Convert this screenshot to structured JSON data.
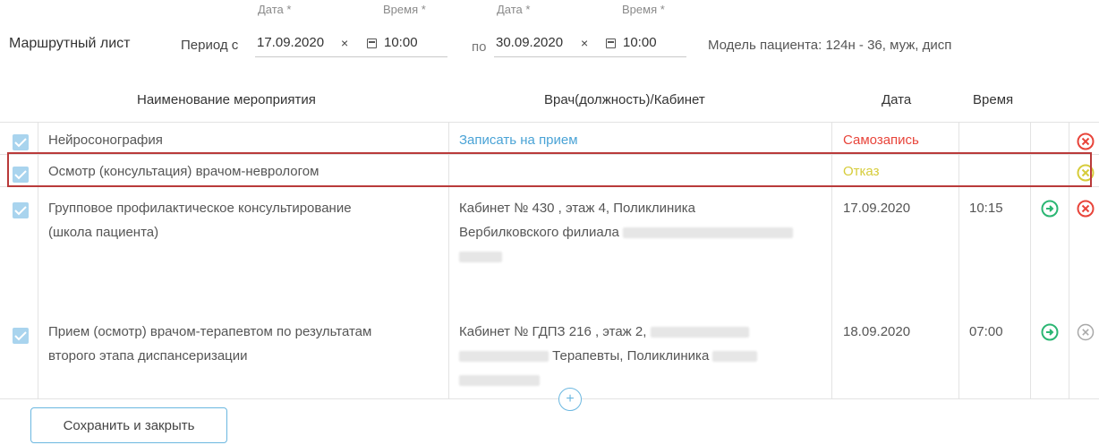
{
  "header": {
    "title": "Маршрутный лист",
    "period_from_label": "Период с",
    "date_from_label": "Дата *",
    "time_from_label": "Время *",
    "date_from": "17.09.2020",
    "time_from": "10:00",
    "to_label": "по",
    "date_to_label": "Дата *",
    "time_to_label": "Время *",
    "date_to": "30.09.2020",
    "time_to": "10:00",
    "clear_symbol": "×",
    "patient_model": "Модель пациента: 124н - 36, муж, дисп"
  },
  "table": {
    "columns": [
      "Наименование мероприятия",
      "Врач(должность)/Кабинет",
      "Дата",
      "Время"
    ],
    "rows": [
      {
        "name": "Нейросонография",
        "doctor": "Записать на прием",
        "date": "Самозапись",
        "time": "",
        "status_icon": "cancel-circle-red-icon"
      },
      {
        "name": "Осмотр (консультация) врачом-неврологом",
        "doctor": "",
        "date": "Отказ",
        "time": "",
        "status_icon": "cancel-circle-yellow-icon"
      },
      {
        "name_line1": "Групповое профилактическое консультирование",
        "name_line2": "(школа пациента)",
        "doctor_line1": "Кабинет № 430 , этаж 4, Поликлиника",
        "doctor_line2": "Вербилковского филиала",
        "date": "17.09.2020",
        "time": "10:15",
        "status_icon": "cancel-circle-red-icon"
      },
      {
        "name_line1": "Прием (осмотр) врачом-терапевтом по результатам",
        "name_line2": "второго этапа диспансеризации",
        "doctor_line1": "Кабинет № ГДПЗ 216 , этаж 2,",
        "doctor_line2": "Терапевты, Поликлиника",
        "date": "18.09.2020",
        "time": "07:00",
        "status_icon": "cancel-circle-gray-icon"
      }
    ]
  },
  "footer": {
    "save_label": "Сохранить и закрыть",
    "add_symbol": "+"
  },
  "colors": {
    "accent": "#6bb7e0",
    "link": "#4aa3d6",
    "danger": "#e8443a",
    "warning": "#d6cc3a",
    "success": "#2bb673",
    "highlight_border": "#b93a3a",
    "checkbox": "#a9d4ee"
  }
}
